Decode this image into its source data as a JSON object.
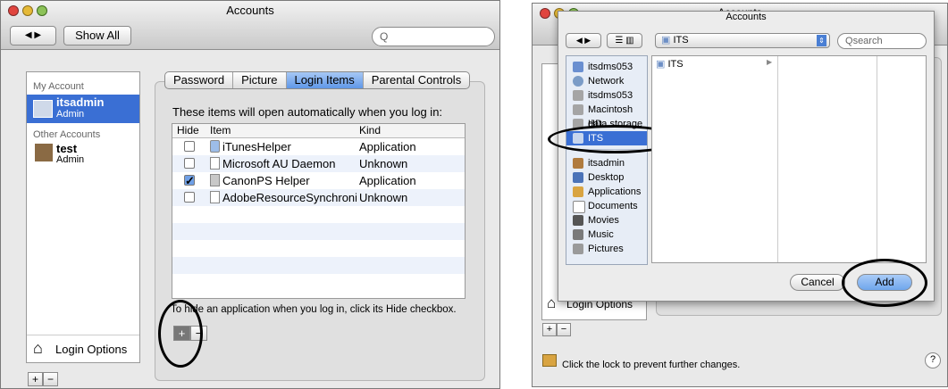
{
  "left": {
    "title": "Accounts",
    "show_all": "Show All",
    "search_placeholder": "",
    "my_account_header": "My Account",
    "my_account": {
      "name": "itsadmin",
      "role": "Admin"
    },
    "other_accounts_header": "Other Accounts",
    "other_account": {
      "name": "test",
      "role": "Admin"
    },
    "login_options": "Login Options",
    "tabs": [
      "Password",
      "Picture",
      "Login Items",
      "Parental Controls"
    ],
    "intro": "These items will open automatically when you log in:",
    "columns": [
      "Hide",
      "Item",
      "Kind"
    ],
    "items": [
      {
        "name": "iTunesHelper",
        "kind": "Application",
        "hide": false
      },
      {
        "name": "Microsoft AU Daemon",
        "kind": "Unknown",
        "hide": false
      },
      {
        "name": "CanonPS Helper",
        "kind": "Application",
        "hide": true
      },
      {
        "name": "AdobeResourceSynchronizer",
        "kind": "Unknown",
        "hide": false
      }
    ],
    "hint": "To hide an application when you log in, click its Hide checkbox.",
    "plus": "+",
    "minus": "−"
  },
  "right": {
    "title": "Accounts",
    "dialog_title": "Accounts",
    "location": "ITS",
    "search_placeholder": "search",
    "sidebar_devices": [
      "itsdms053",
      "Network",
      "itsdms053",
      "Macintosh HD",
      "data storage",
      "ITS"
    ],
    "sidebar_places": [
      "itsadmin",
      "Desktop",
      "Applications",
      "Documents",
      "Movies",
      "Music",
      "Pictures"
    ],
    "column_item": "ITS",
    "cancel": "Cancel",
    "add": "Add",
    "login_options": "Login Options",
    "lock_text": "Click the lock to prevent further changes.",
    "help": "?",
    "plus": "+",
    "minus": "−"
  },
  "colors": {
    "selection": "#3a6fd4",
    "add_button": "#6fa6ec"
  }
}
